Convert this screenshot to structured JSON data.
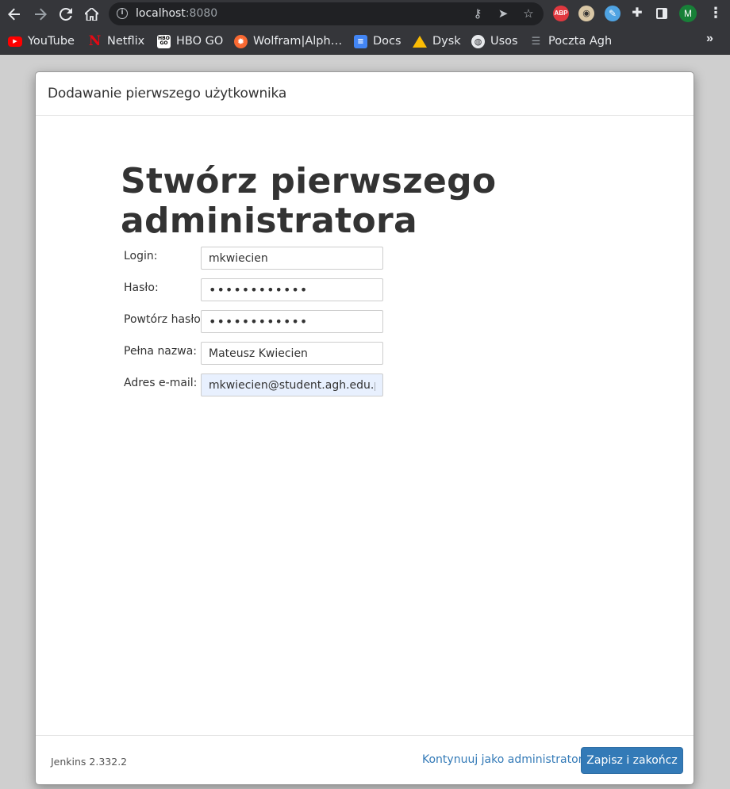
{
  "browser": {
    "url_host": "localhost",
    "url_port": ":8080",
    "profile_initial": "M",
    "extensions": {
      "adblock_label": "ABP"
    }
  },
  "bookmarks": [
    {
      "label": "YouTube",
      "icon": "youtube-icon"
    },
    {
      "label": "Netflix",
      "icon": "netflix-icon"
    },
    {
      "label": "HBO GO",
      "icon": "hbo-icon"
    },
    {
      "label": "Wolfram|Alph…",
      "icon": "wolfram-icon"
    },
    {
      "label": "Docs",
      "icon": "docs-icon"
    },
    {
      "label": "Dysk",
      "icon": "drive-icon"
    },
    {
      "label": "Usos",
      "icon": "globe-icon"
    },
    {
      "label": "Poczta Agh",
      "icon": "mail-icon"
    }
  ],
  "dialog": {
    "title": "Dodawanie pierwszego użytkownika",
    "heading": "Stwórz pierwszego administratora",
    "form": {
      "login_label": "Login:",
      "login_value": "mkwiecien",
      "password_label": "Hasło:",
      "password_value": "••••••••••••",
      "confirm_label": "Powtórz hasło:",
      "confirm_value": "••••••••••••",
      "fullname_label": "Pełna nazwa:",
      "fullname_value": "Mateusz Kwiecien",
      "email_label": "Adres e-mail:",
      "email_value": "mkwiecien@student.agh.edu.pl"
    },
    "footer": {
      "version": "Jenkins 2.332.2",
      "continue_link": "Kontynuuj jako administrator",
      "save_button": "Zapisz i zakończ"
    }
  },
  "colors": {
    "primary": "#337ab7",
    "browser_chrome": "#35363a",
    "page_background": "#cfcfcf",
    "autofill": "#e8f0fe"
  }
}
